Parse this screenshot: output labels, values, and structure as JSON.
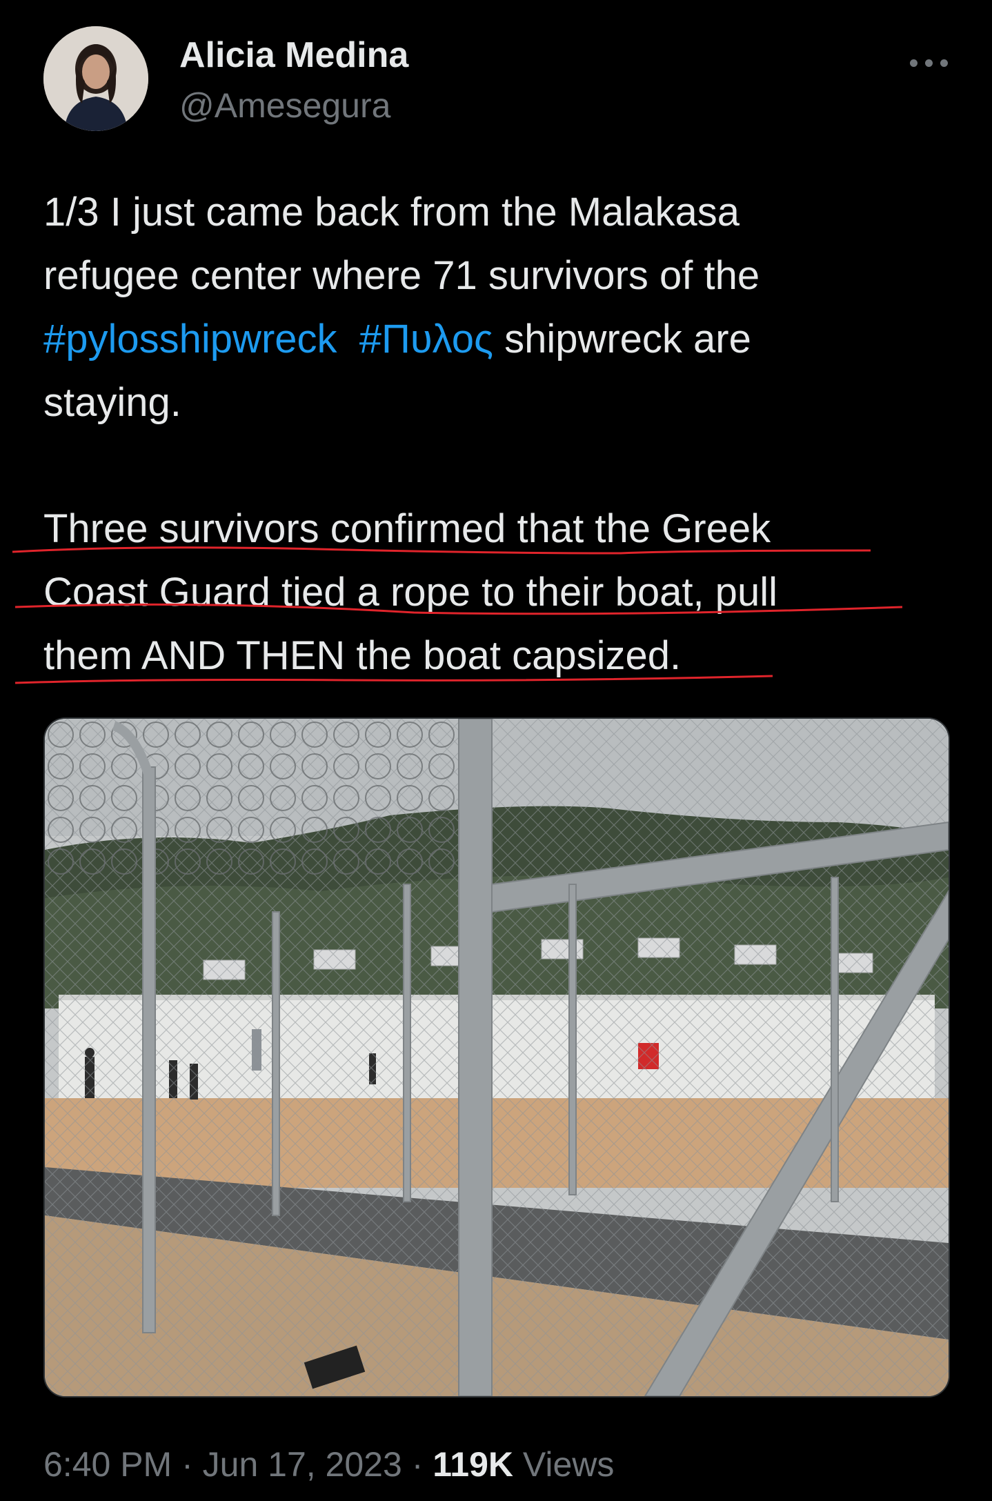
{
  "author": {
    "name": "Alicia Medina",
    "handle": "@Amesegura"
  },
  "tweet": {
    "line1_prefix": "1/3 I just came back from the Malakasa\nrefugee center where 71 survivors of the\n",
    "hashtag1": "#pylosshipwreck",
    "hashtag2": "#Πυλος",
    "line_suffix": " shipwreck are\nstaying.",
    "para2_line1": "Three survivors confirmed that the Greek",
    "para2_line2": "Coast Guard tied a rope to their boat, pull",
    "para2_line3": "them AND THEN the boat capsized."
  },
  "meta": {
    "time": "6:40 PM",
    "sep1": " · ",
    "date": "Jun 17, 2023",
    "sep2": " · ",
    "views_count": "119K",
    "views_label": " Views"
  },
  "colors": {
    "background": "#000000",
    "text": "#e7e9ea",
    "muted": "#71767b",
    "link": "#1d9bf0",
    "annotation": "#e0242b"
  },
  "icons": {
    "more": "more-horizontal-icon"
  }
}
